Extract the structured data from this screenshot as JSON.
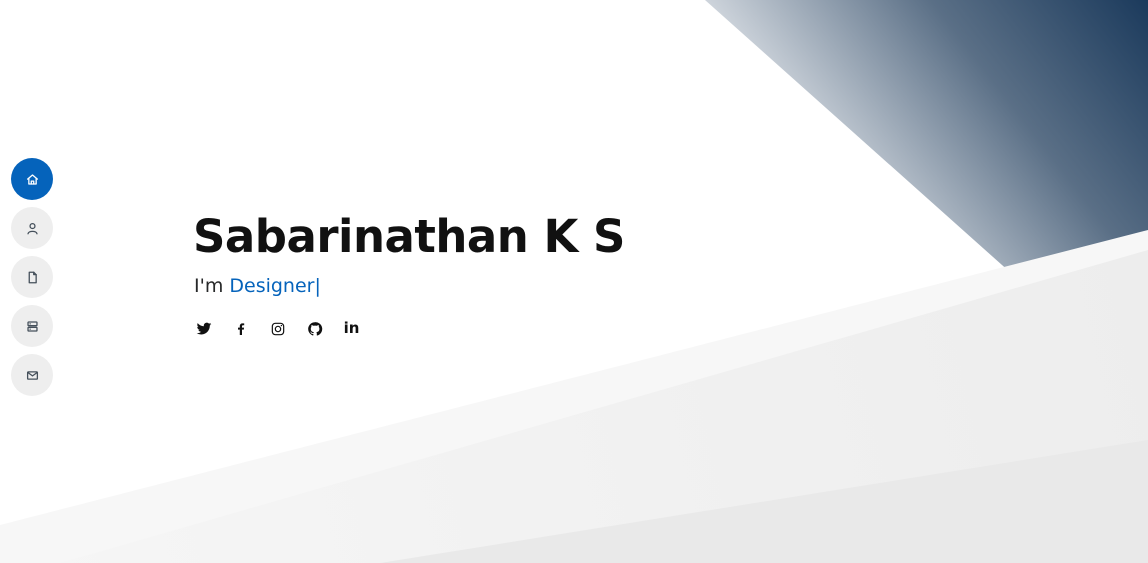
{
  "hero": {
    "name": "Sabarinathan K S",
    "prefix": "I'm ",
    "typed_text": "Designer",
    "cursor": "|"
  },
  "side_nav": {
    "items": [
      {
        "icon": "home-icon",
        "active": true
      },
      {
        "icon": "person-icon",
        "active": false
      },
      {
        "icon": "file-icon",
        "active": false
      },
      {
        "icon": "server-icon",
        "active": false
      },
      {
        "icon": "envelope-icon",
        "active": false
      }
    ]
  },
  "social_links": [
    {
      "icon": "twitter-icon"
    },
    {
      "icon": "facebook-icon"
    },
    {
      "icon": "instagram-icon"
    },
    {
      "icon": "github-icon"
    },
    {
      "icon": "linkedin-icon",
      "glyph": "in"
    }
  ],
  "colors": {
    "accent": "#0563bb",
    "nav_bg": "#eeeeee",
    "heading": "#111111",
    "gradient_dark": "#1b3a5c"
  }
}
